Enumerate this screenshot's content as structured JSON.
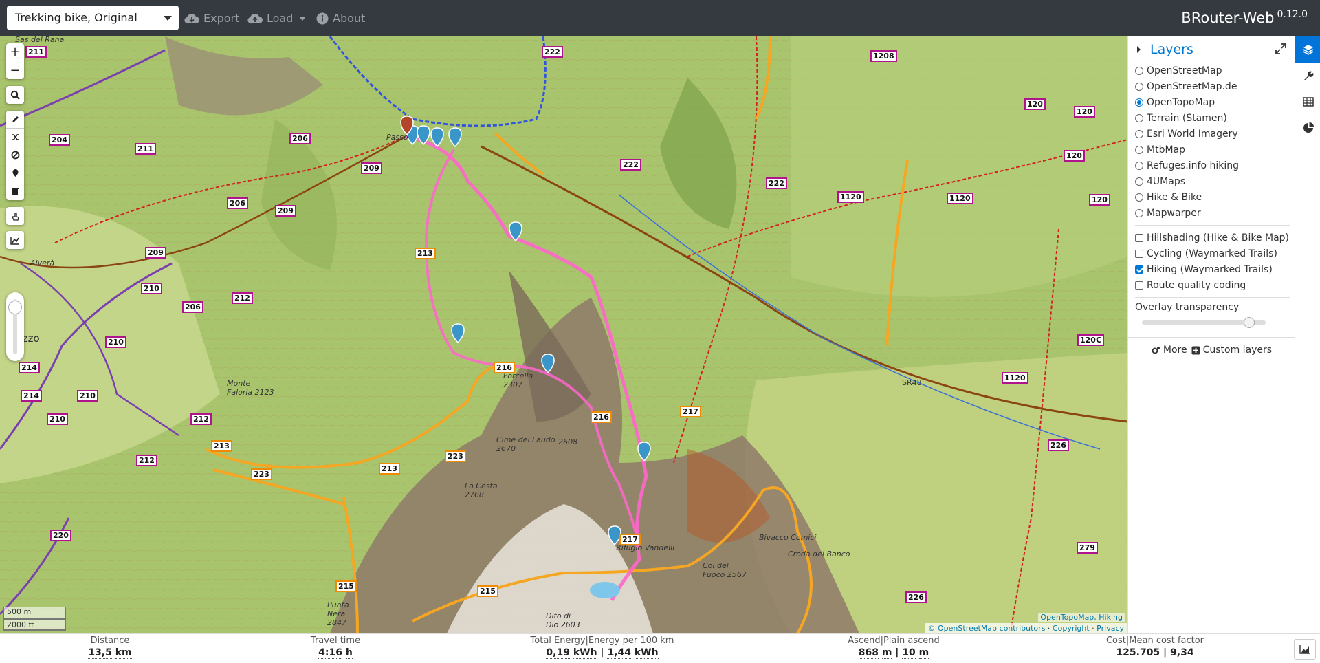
{
  "navbar": {
    "profile": "Trekking bike, Original",
    "export": "Export",
    "load": "Load",
    "about": "About",
    "brand": "BRouter-Web",
    "version": "0.12.0"
  },
  "map": {
    "scale_metric": "500 m",
    "scale_imperial": "2000 ft",
    "attribution_top": "OpenTopoMap, Hiking",
    "attribution_osm": "© OpenStreetMap contributors",
    "attribution_copyright": "Copyright",
    "attribution_privacy": "Privacy",
    "places": [
      {
        "name": "Sas del Rana"
      },
      {
        "name": "Alverà"
      },
      {
        "name": "pezzo"
      },
      {
        "name": "Monte Faloria 2123"
      },
      {
        "name": "Forcella 2307"
      },
      {
        "name": "Cime del Laudo 2670"
      },
      {
        "name": "2608"
      },
      {
        "name": "La Cesta 2768"
      },
      {
        "name": "Bivacco Comici"
      },
      {
        "name": "Croda del Banco"
      },
      {
        "name": "Col del Fuoco 2567"
      },
      {
        "name": "Punta Nera 2847"
      },
      {
        "name": "Dito di Dio 2603"
      },
      {
        "name": "SR48"
      },
      {
        "name": "Passo"
      },
      {
        "name": "Rifugio Vandelli"
      }
    ],
    "trail_shields": [
      "211",
      "204",
      "206",
      "211",
      "209",
      "206",
      "209",
      "209",
      "210",
      "212",
      "206",
      "210",
      "214",
      "214",
      "210",
      "210",
      "212",
      "213",
      "223",
      "213",
      "212",
      "223",
      "220",
      "215",
      "215",
      "216",
      "216",
      "217",
      "217",
      "213",
      "222",
      "222",
      "222",
      "1208",
      "120",
      "120",
      "120",
      "1120",
      "1120",
      "120",
      "120C",
      "1120",
      "226",
      "279",
      "226"
    ]
  },
  "sidebar": {
    "title": "Layers",
    "base_layers": [
      {
        "label": "OpenStreetMap",
        "selected": false
      },
      {
        "label": "OpenStreetMap.de",
        "selected": false
      },
      {
        "label": "OpenTopoMap",
        "selected": true
      },
      {
        "label": "Terrain (Stamen)",
        "selected": false
      },
      {
        "label": "Esri World Imagery",
        "selected": false
      },
      {
        "label": "MtbMap",
        "selected": false
      },
      {
        "label": "Refuges.info hiking",
        "selected": false
      },
      {
        "label": "4UMaps",
        "selected": false
      },
      {
        "label": "Hike & Bike",
        "selected": false
      },
      {
        "label": "Mapwarper",
        "selected": false
      }
    ],
    "overlays": [
      {
        "label": "Hillshading (Hike & Bike Map)",
        "checked": false
      },
      {
        "label": "Cycling (Waymarked Trails)",
        "checked": false
      },
      {
        "label": "Hiking (Waymarked Trails)",
        "checked": true
      },
      {
        "label": "Route quality coding",
        "checked": false
      }
    ],
    "overlay_transparency_label": "Overlay transparency",
    "overlay_transparency_value": 0.85,
    "more": "More",
    "custom_layers": "Custom layers"
  },
  "footer": {
    "distance_label": "Distance",
    "distance_value": "13,5",
    "distance_unit": "km",
    "time_label": "Travel time",
    "time_value": "4:16",
    "time_unit": "h",
    "energy_label": "Total Energy|Energy per 100 km",
    "energy_total": "0,19",
    "energy_total_unit": "kWh",
    "energy_per": "1,44",
    "energy_per_unit": "kWh",
    "ascend_label": "Ascend|Plain ascend",
    "ascend_value": "868",
    "ascend_unit": "m",
    "plain_value": "10",
    "plain_unit": "m",
    "cost_label": "Cost|Mean cost factor",
    "cost_value": "125.705 | 9,34"
  },
  "colors": {
    "navbar": "#343a40",
    "accent": "#0078d4",
    "route": "#ff66cc",
    "trail_orange": "#f5a623",
    "trail_purple": "#7b3fb0"
  }
}
